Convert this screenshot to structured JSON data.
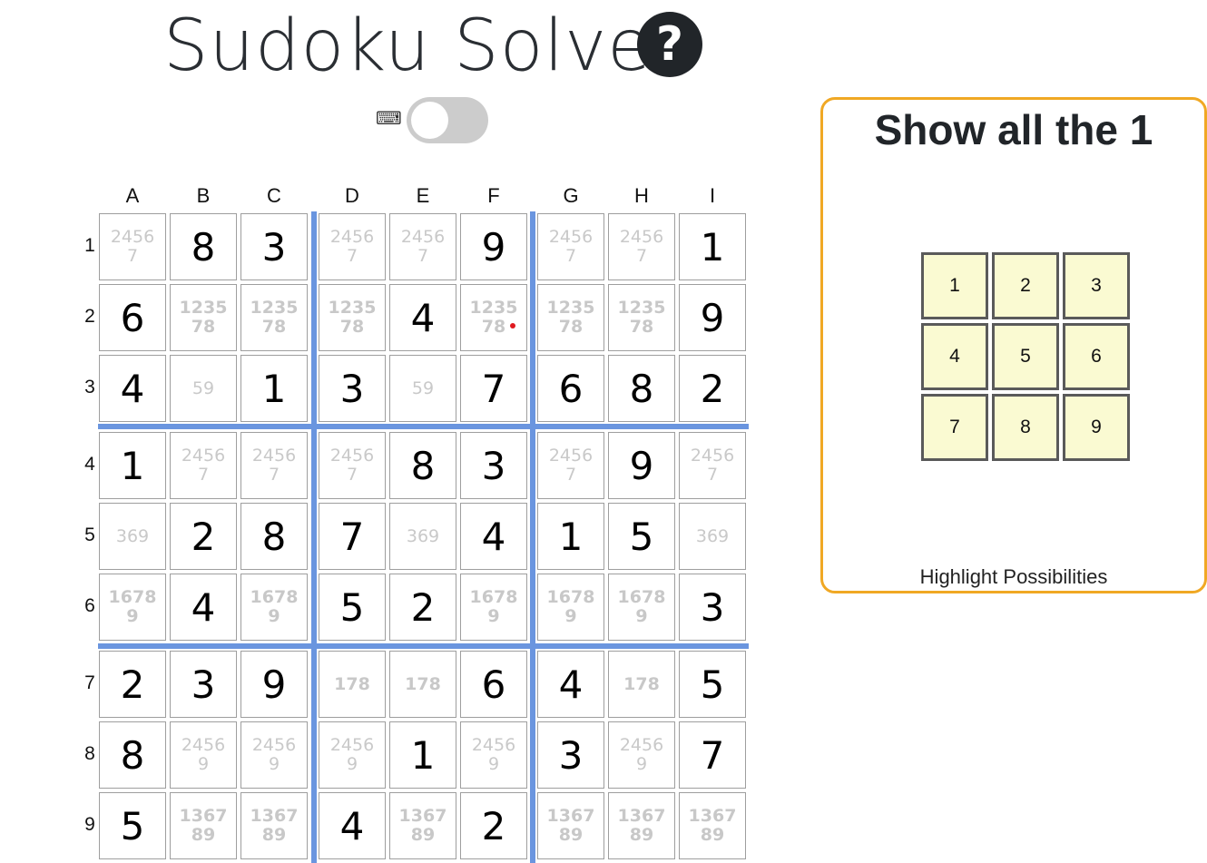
{
  "header": {
    "title": "Sudoku Solver",
    "help_label": "?",
    "keyboard_icon": "⌨"
  },
  "board": {
    "columns": [
      "A",
      "B",
      "C",
      "D",
      "E",
      "F",
      "G",
      "H",
      "I"
    ],
    "rows": [
      "1",
      "2",
      "3",
      "4",
      "5",
      "6",
      "7",
      "8",
      "9"
    ],
    "cells": [
      [
        "c:24567",
        "8",
        "3",
        "c:24567",
        "c:24567",
        "9",
        "c:24567",
        "c:24567",
        "1"
      ],
      [
        "6",
        "C:123578",
        "C:123578",
        "C:123578",
        "4",
        "C:123578",
        "C:123578",
        "C:123578",
        "9"
      ],
      [
        "4",
        "c:59",
        "1",
        "3",
        "c:59",
        "7",
        "6",
        "8",
        "2"
      ],
      [
        "1",
        "c:24567",
        "c:24567",
        "c:24567",
        "8",
        "3",
        "c:24567",
        "9",
        "c:24567"
      ],
      [
        "c:369",
        "2",
        "8",
        "7",
        "c:369",
        "4",
        "1",
        "5",
        "c:369"
      ],
      [
        "C:16789",
        "4",
        "C:16789",
        "5",
        "2",
        "C:16789",
        "C:16789",
        "C:16789",
        "3"
      ],
      [
        "2",
        "3",
        "9",
        "C:178",
        "C:178",
        "6",
        "4",
        "C:178",
        "5"
      ],
      [
        "8",
        "c:24569",
        "c:24569",
        "c:24569",
        "1",
        "c:24569",
        "3",
        "c:24569",
        "7"
      ],
      [
        "5",
        "C:136789",
        "C:136789",
        "4",
        "C:136789",
        "2",
        "C:136789",
        "C:136789",
        "C:136789"
      ]
    ]
  },
  "panel": {
    "title": "Show all the 1",
    "buttons": [
      "1",
      "2",
      "3",
      "4",
      "5",
      "6",
      "7",
      "8",
      "9"
    ],
    "caption": "Highlight Possibilities"
  },
  "colors": {
    "accent_border": "#f0a824",
    "grid_divider": "#6a95df",
    "pad_fill": "#fafad2",
    "marker": "#e0191f"
  }
}
